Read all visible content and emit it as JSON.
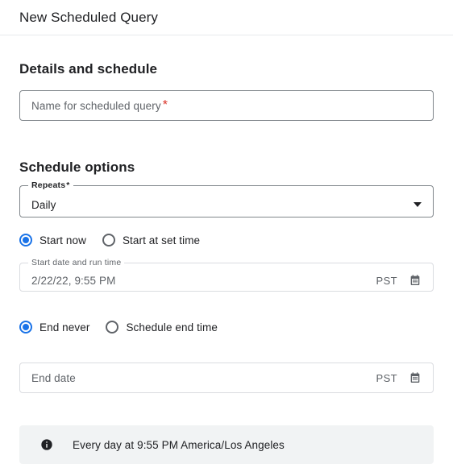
{
  "header": {
    "title": "New Scheduled Query"
  },
  "details_section": {
    "heading": "Details and schedule",
    "name_field": {
      "name": "scheduled-query-name",
      "value": "",
      "placeholder": "Name for scheduled query",
      "required_marker": "*",
      "required": true
    }
  },
  "schedule_section": {
    "heading": "Schedule options",
    "repeats": {
      "label": "Repeats",
      "required_marker": "*",
      "selected": "Daily",
      "options": [
        "Daily"
      ]
    },
    "start_radio_group": {
      "options": [
        {
          "label": "Start now",
          "selected": true
        },
        {
          "label": "Start at set time",
          "selected": false
        }
      ]
    },
    "start_date_field": {
      "label": "Start date and run time",
      "value": "2/22/22, 9:55 PM",
      "timezone": "PST",
      "disabled": true,
      "icon": "calendar-icon"
    },
    "end_radio_group": {
      "options": [
        {
          "label": "End never",
          "selected": true
        },
        {
          "label": "Schedule end time",
          "selected": false
        }
      ]
    },
    "end_date_field": {
      "label": "",
      "value": "",
      "placeholder": "End date",
      "timezone": "PST",
      "disabled": true,
      "icon": "calendar-icon"
    },
    "info_banner": {
      "icon": "info-icon",
      "text": "Every day at 9:55 PM America/Los Angeles"
    }
  },
  "colors": {
    "accent": "#1a73e8",
    "required": "#d93025",
    "text_primary": "#202124",
    "text_secondary": "#5f6368",
    "border": "#80868b",
    "border_disabled": "#dadce0",
    "banner_bg": "#f1f3f4"
  }
}
